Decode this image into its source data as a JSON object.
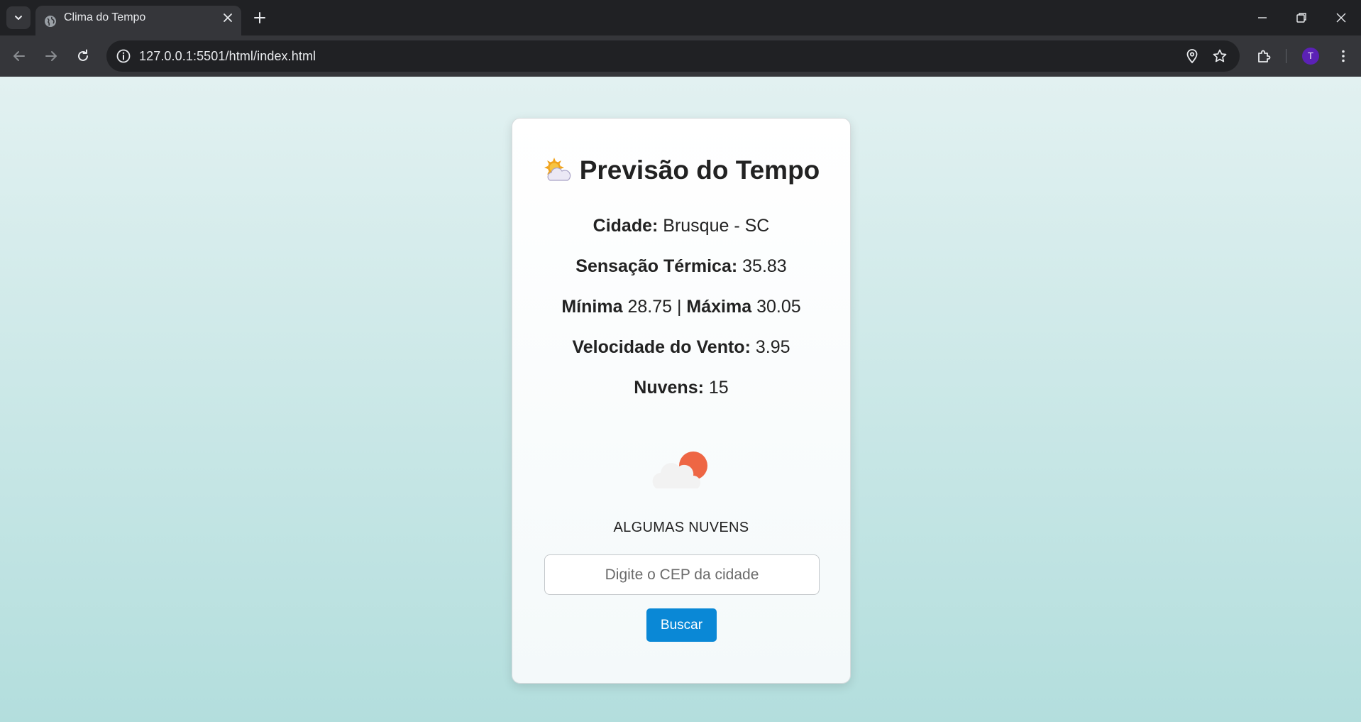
{
  "browser": {
    "tab_title": "Clima do Tempo",
    "url": "127.0.0.1:5501/html/index.html",
    "profile_initial": "T",
    "profile_color": "#5b21b6"
  },
  "page": {
    "title": "Previsão do Tempo",
    "title_icon": "sun-behind-cloud-icon",
    "city": {
      "label": "Cidade:",
      "value": "Brusque - SC"
    },
    "feels_like": {
      "label": "Sensação Térmica:",
      "value": "35.83"
    },
    "min_temp": {
      "label": "Mínima",
      "value": "28.75"
    },
    "max_temp": {
      "label": "Máxima",
      "value": "30.05"
    },
    "min_max_separator": "|",
    "wind": {
      "label": "Velocidade do Vento:",
      "value": "3.95"
    },
    "clouds": {
      "label": "Nuvens:",
      "value": "15"
    },
    "weather_icon": "few-clouds-icon",
    "description": "ALGUMAS NUVENS",
    "search": {
      "placeholder": "Digite o CEP da cidade",
      "value": "",
      "button_label": "Buscar"
    }
  },
  "colors": {
    "button": "#0a88d6",
    "background_top": "#e2f1f1",
    "background_bottom": "#b3dedd"
  }
}
